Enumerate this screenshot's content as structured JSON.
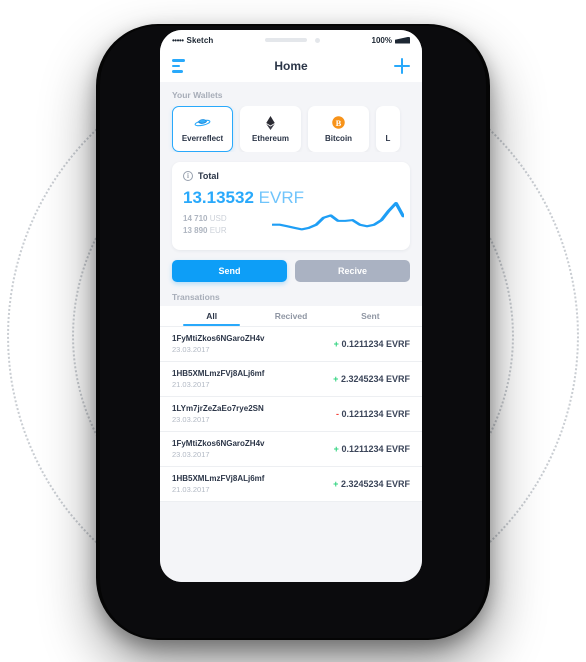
{
  "status_bar": {
    "signal_dots": "•••••",
    "carrier": "Sketch",
    "battery_percent": "100%"
  },
  "nav": {
    "menu_icon": "hamburger-icon",
    "title": "Home",
    "add_icon": "plus-icon"
  },
  "wallets": {
    "section_label": "Your Wallets",
    "items": [
      {
        "label": "Everreflect",
        "icon": "everreflect-logo-icon",
        "selected": true
      },
      {
        "label": "Ethereum",
        "icon": "ethereum-logo-icon",
        "selected": false
      },
      {
        "label": "Bitcoin",
        "icon": "bitcoin-logo-icon",
        "selected": false
      },
      {
        "label": "L",
        "icon": "litecoin-logo-icon",
        "selected": false
      }
    ]
  },
  "balance": {
    "info_icon": "info-icon",
    "total_label": "Total",
    "amount": "13.13532",
    "currency": "EVRF",
    "fiat": [
      {
        "value": "14 710",
        "currency": "USD"
      },
      {
        "value": "13 890",
        "currency": "EUR"
      }
    ]
  },
  "actions": {
    "send_label": "Send",
    "receive_label": "Recive"
  },
  "transactions": {
    "section_label": "Transations",
    "tabs": [
      {
        "label": "All",
        "active": true
      },
      {
        "label": "Recived",
        "active": false
      },
      {
        "label": "Sent",
        "active": false
      }
    ],
    "rows": [
      {
        "address": "1FyMtiZkos6NGaroZH4v",
        "date": "23.03.2017",
        "sign": "+",
        "amount": "0.1211234",
        "currency": "EVRF"
      },
      {
        "address": "1HB5XMLmzFVj8ALj6mf",
        "date": "21.03.2017",
        "sign": "+",
        "amount": "2.3245234",
        "currency": "EVRF"
      },
      {
        "address": "1LYm7jrZeZaEo7rye2SN",
        "date": "23.03.2017",
        "sign": "-",
        "amount": "0.1211234",
        "currency": "EVRF"
      },
      {
        "address": "1FyMtiZkos6NGaroZH4v",
        "date": "23.03.2017",
        "sign": "+",
        "amount": "0.1211234",
        "currency": "EVRF"
      },
      {
        "address": "1HB5XMLmzFVj8ALj6mf",
        "date": "21.03.2017",
        "sign": "+",
        "amount": "2.3245234",
        "currency": "EVRF"
      }
    ]
  },
  "chart_data": {
    "type": "line",
    "title": "",
    "xlabel": "",
    "ylabel": "",
    "x": [
      0,
      1,
      2,
      3,
      4,
      5,
      6,
      7,
      8,
      9,
      10,
      11,
      12,
      13,
      14,
      15,
      16,
      17,
      18
    ],
    "values": [
      30,
      30,
      26,
      22,
      18,
      22,
      30,
      48,
      54,
      40,
      40,
      42,
      30,
      26,
      30,
      42,
      66,
      86,
      52
    ],
    "ylim": [
      0,
      100
    ],
    "grid": false,
    "legend": "none",
    "color": "#1e9ef5"
  },
  "colors": {
    "accent_blue": "#29a9fb",
    "send_blue": "#0d9ef7",
    "receive_gray": "#aab2c2",
    "positive_green": "#2fd37f",
    "negative_red": "#f4433c",
    "text_dark": "#2c3648",
    "text_muted": "#a7adb8",
    "screen_bg": "#f4f5f8",
    "bitcoin_orange": "#f7931a"
  }
}
